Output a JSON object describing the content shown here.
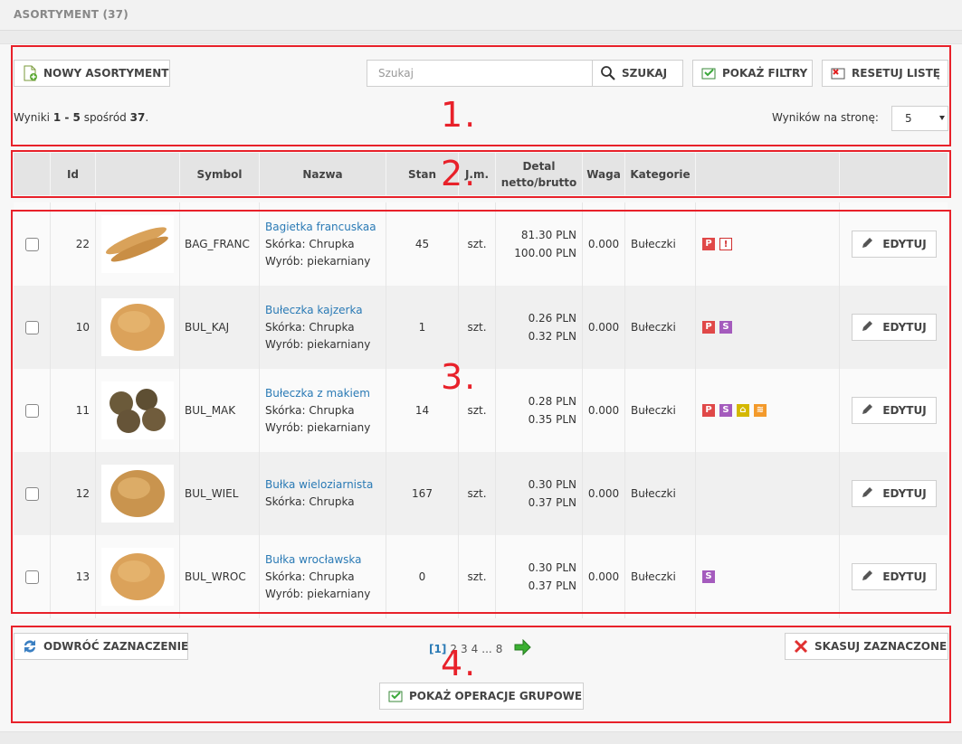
{
  "header": {
    "title": "ASORTYMENT (37)"
  },
  "toolbar": {
    "new_label": "NOWY ASORTYMENT",
    "search_placeholder": "Szukaj",
    "search_label": "SZUKAJ",
    "filters_label": "POKAŻ FILTRY",
    "reset_label": "RESETUJ LISTĘ"
  },
  "results": {
    "prefix": "Wyniki",
    "range": "1 - 5",
    "of": "spośród",
    "total": "37",
    "period": "."
  },
  "per_page": {
    "label": "Wyników na stronę:",
    "value": "5"
  },
  "table": {
    "headers": {
      "id": "Id",
      "symbol": "Symbol",
      "nazwa": "Nazwa",
      "stan": "Stan",
      "jm": "J.m.",
      "detal_1": "Detal",
      "detal_2": "netto/brutto",
      "waga": "Waga",
      "kategorie": "Kategorie"
    },
    "rows": [
      {
        "id": "22",
        "symbol": "BAG_FRANC",
        "name": "Bagietka francuskaa",
        "line2": "Skórka: Chrupka",
        "line3": "Wyrób: piekarniany",
        "stan": "45",
        "jm": "szt.",
        "net": "81.30 PLN",
        "gross": "100.00 PLN",
        "waga": "0.000",
        "kategoria": "Bułeczki",
        "edit": "EDYTUJ"
      },
      {
        "id": "10",
        "symbol": "BUL_KAJ",
        "name": "Bułeczka kajzerka",
        "line2": "Skórka: Chrupka",
        "line3": "Wyrób: piekarniany",
        "stan": "1",
        "jm": "szt.",
        "net": "0.26 PLN",
        "gross": "0.32 PLN",
        "waga": "0.000",
        "kategoria": "Bułeczki",
        "edit": "EDYTUJ"
      },
      {
        "id": "11",
        "symbol": "BUL_MAK",
        "name": "Bułeczka z makiem",
        "line2": "Skórka: Chrupka",
        "line3": "Wyrób: piekarniany",
        "stan": "14",
        "jm": "szt.",
        "net": "0.28 PLN",
        "gross": "0.35 PLN",
        "waga": "0.000",
        "kategoria": "Bułeczki",
        "edit": "EDYTUJ"
      },
      {
        "id": "12",
        "symbol": "BUL_WIEL",
        "name": "Bułka wieloziarnista",
        "line2": "Skórka: Chrupka",
        "line3": "",
        "stan": "167",
        "jm": "szt.",
        "net": "0.30 PLN",
        "gross": "0.37 PLN",
        "waga": "0.000",
        "kategoria": "Bułeczki",
        "edit": "EDYTUJ"
      },
      {
        "id": "13",
        "symbol": "BUL_WROC",
        "name": "Bułka wrocławska",
        "line2": "Skórka: Chrupka",
        "line3": "Wyrób: piekarniany",
        "stan": "0",
        "jm": "szt.",
        "net": "0.30 PLN",
        "gross": "0.37 PLN",
        "waga": "0.000",
        "kategoria": "Bułeczki",
        "edit": "EDYTUJ"
      }
    ]
  },
  "badges": {
    "p": "P",
    "s": "S",
    "p_color": "#e04848",
    "s_color": "#a45bbd",
    "home_color": "#d4b800",
    "rss_color": "#f39a2b"
  },
  "footer": {
    "invert_label": "ODWRÓĆ ZAZNACZENIE",
    "delete_label": "SKASUJ ZAZNACZONE",
    "group_label": "POKAŻ OPERACJE GRUPOWE",
    "pages": {
      "current": "[1]",
      "p2": "2",
      "p3": "3",
      "p4": "4",
      "ellipsis": "...",
      "last": "8"
    }
  },
  "annotations": {
    "n1": "1.",
    "n2": "2.",
    "n3": "3.",
    "n4": "4."
  }
}
